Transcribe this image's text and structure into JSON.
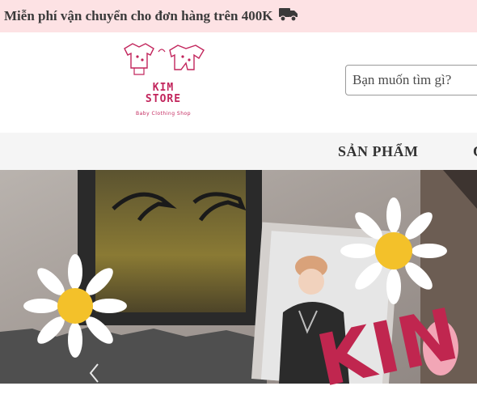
{
  "topbar": {
    "promo_text": "Miễn phí vận chuyển cho đơn hàng trên 400K",
    "icon": "truck-icon",
    "background": "#fde2e4"
  },
  "logo": {
    "main_text": "KIM\nSTORE",
    "subtitle": "Baby Clothing Shop",
    "color": "#c2255c"
  },
  "search": {
    "placeholder": "Bạn muốn tìm gì?"
  },
  "nav": {
    "items": [
      {
        "label": "SẢN PHẨM"
      },
      {
        "label": "C"
      }
    ]
  },
  "banner": {
    "title_fragment": "KIN",
    "prev_icon": "chevron-left-icon"
  }
}
